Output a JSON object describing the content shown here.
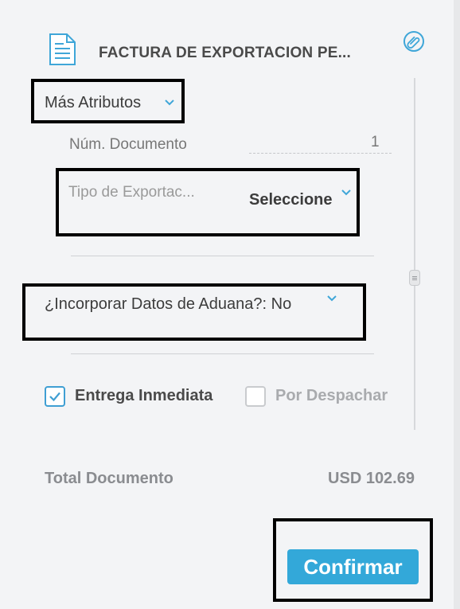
{
  "header": {
    "title": "FACTURA DE EXPORTACION PE...",
    "doc_icon": "document-icon",
    "attach_icon": "paperclip-icon"
  },
  "attributes": {
    "toggle_label": "Más Atributos",
    "num_documento_label": "Núm. Documento",
    "num_documento_value": "1",
    "tipo_exportacion_label": "Tipo de Exportac...",
    "tipo_exportacion_value": "Seleccione",
    "aduana_label": "¿Incorporar Datos de Aduana?: No"
  },
  "options": {
    "entrega_inmediata_label": "Entrega Inmediata",
    "entrega_inmediata_checked": true,
    "por_despachar_label": "Por Despachar",
    "por_despachar_checked": false
  },
  "totals": {
    "label": "Total Documento",
    "value": "USD 102.69"
  },
  "actions": {
    "confirm_label": "Confirmar"
  },
  "colors": {
    "accent": "#33a8d9",
    "background": "#f3f4f6",
    "highlight_box": "#000000"
  }
}
